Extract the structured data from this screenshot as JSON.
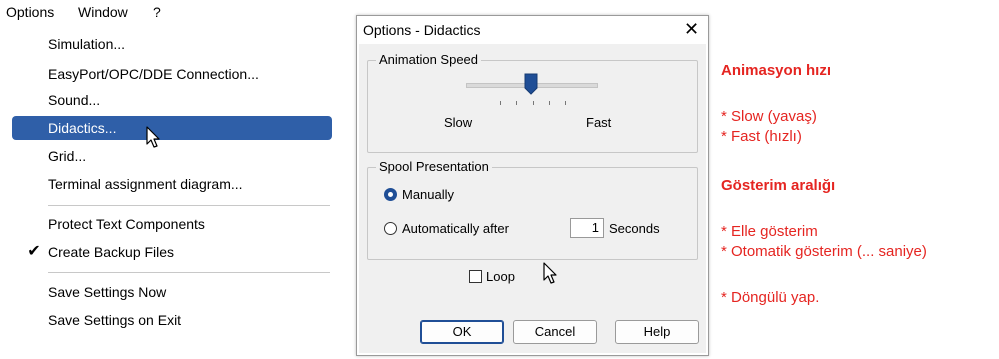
{
  "menubar": {
    "options": "Options",
    "window": "Window",
    "help": "?"
  },
  "menu": {
    "items": [
      {
        "label": "Simulation..."
      },
      {
        "label": "EasyPort/OPC/DDE Connection..."
      },
      {
        "label": "Sound..."
      },
      {
        "label": "Didactics...",
        "highlighted": true
      },
      {
        "label": "Grid..."
      },
      {
        "label": "Terminal assignment diagram..."
      },
      {
        "label": "Protect Text Components"
      },
      {
        "label": "Create Backup Files",
        "checked": true
      },
      {
        "label": "Save Settings Now"
      },
      {
        "label": "Save Settings on Exit"
      }
    ],
    "check_glyph": "✔"
  },
  "dialog": {
    "title": "Options - Didactics",
    "close_glyph": "✕",
    "animation_speed": {
      "group_label": "Animation Speed",
      "slow_label": "Slow",
      "fast_label": "Fast",
      "slider_level": 0.5
    },
    "spool": {
      "group_label": "Spool Presentation",
      "manually_label": "Manually",
      "manually_selected": true,
      "auto_label": "Automatically after",
      "seconds_value": "1",
      "seconds_label": "Seconds"
    },
    "loop_label": "Loop",
    "loop_checked": false,
    "buttons": {
      "ok": "OK",
      "cancel": "Cancel",
      "help": "Help"
    }
  },
  "annotations": {
    "speed_heading": "Animasyon hızı",
    "slow": "* Slow (yavaş)",
    "fast": "* Fast (hızlı)",
    "spool_heading": "Gösterim aralığı",
    "manual": "* Elle gösterim",
    "auto": "* Otomatik gösterim (... saniye)",
    "loop": "* Döngülü yap."
  },
  "colors": {
    "highlight": "#2f5fa8",
    "annotation": "#e52521",
    "radio_selected": "#1f4e96"
  }
}
